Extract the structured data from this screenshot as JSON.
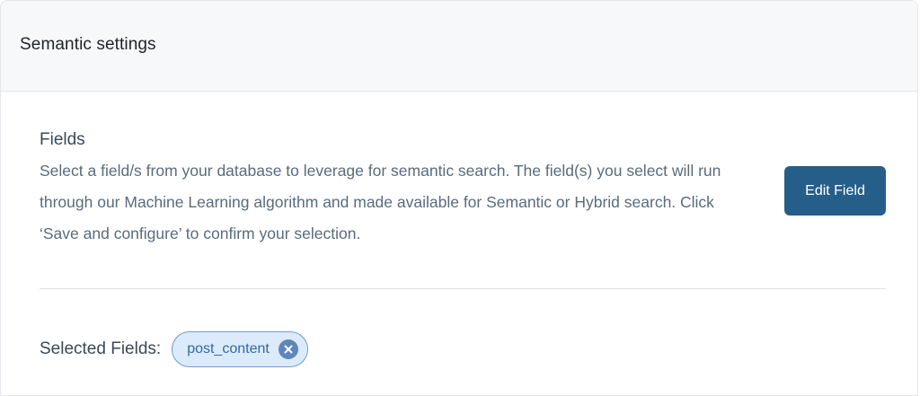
{
  "header": {
    "title": "Semantic settings"
  },
  "fields_section": {
    "title": "Fields",
    "description": "Select a field/s from your database to leverage for semantic search. The field(s) you select will run through our Machine Learning algorithm and made available for Semantic or Hybrid search. Click ‘Save and configure’ to confirm your selection.",
    "edit_button_label": "Edit Field"
  },
  "selected": {
    "label": "Selected Fields:",
    "chips": [
      {
        "label": "post_content",
        "remove_icon": "close-circle-icon"
      }
    ]
  },
  "colors": {
    "button_bg": "#265e8a",
    "chip_bg": "#dcebfb",
    "chip_border": "#6f9dce",
    "chip_text": "#2f6aa3"
  }
}
